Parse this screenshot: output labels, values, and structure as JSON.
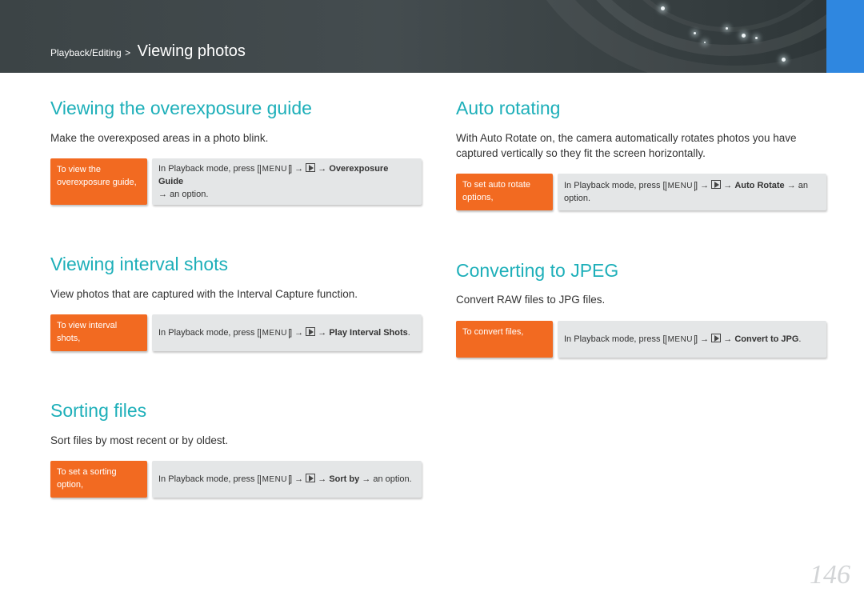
{
  "header": {
    "parent": "Playback/Editing",
    "separator": ">",
    "current": "Viewing photos"
  },
  "steps_common": {
    "prefix": "In Playback mode, press",
    "menu_key": "MENU",
    "arrow": "→"
  },
  "sections": {
    "overexposure": {
      "title": "Viewing the overexposure guide",
      "description": "Make the overexposed areas in a photo blink.",
      "label": "To view the overexposure guide,",
      "option": "Overexposure Guide",
      "suffix": "an option."
    },
    "interval": {
      "title": "Viewing interval shots",
      "description": "View photos that are captured with the Interval Capture function.",
      "label": "To view interval shots,",
      "option": "Play Interval Shots",
      "suffix": "."
    },
    "sorting": {
      "title": "Sorting files",
      "description": "Sort files by most recent or by oldest.",
      "label": "To set a sorting option,",
      "option": "Sort by",
      "suffix": "an option."
    },
    "autorotate": {
      "title": "Auto rotating",
      "description": "With Auto Rotate on, the camera automatically rotates photos you have captured vertically so they fit the screen horizontally.",
      "label": "To set auto rotate options,",
      "option": "Auto Rotate",
      "suffix": "an option."
    },
    "jpeg": {
      "title": "Converting to JPEG",
      "description": "Convert RAW files to JPG files.",
      "label": "To convert files,",
      "option": "Convert to JPG",
      "suffix": "."
    }
  },
  "page_number": "146",
  "colors": {
    "title": "#1dafb9",
    "label_bg": "#f26a21",
    "box_bg": "#e4e6e7",
    "header_bg": "#3f4749",
    "tab": "#2f87e0"
  }
}
